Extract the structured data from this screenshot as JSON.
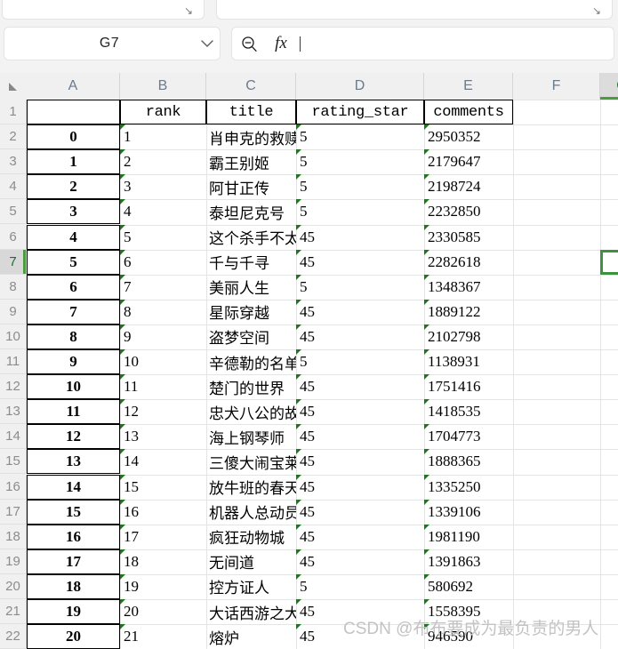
{
  "app": {
    "name_box_value": "G7",
    "name_box_chevron": "chevron-down-icon",
    "formula_value": "",
    "formula_placeholder": "",
    "zoom_out_icon": "magnifier-minus-icon",
    "fx_label": "fx"
  },
  "grid": {
    "column_headers": [
      "A",
      "B",
      "C",
      "D",
      "E",
      "F",
      "G"
    ],
    "selected_column": "G",
    "selected_row": 7,
    "selected_cell": "G7",
    "row_numbers": [
      1,
      2,
      3,
      4,
      5,
      6,
      7,
      8,
      9,
      10,
      11,
      12,
      13,
      14,
      15,
      16,
      17,
      18,
      19,
      20,
      21,
      22
    ],
    "header_row": {
      "A": "",
      "B": "rank",
      "C": "title",
      "D": "rating_star",
      "E": "comments"
    },
    "rows": [
      {
        "index": "0",
        "rank": "1",
        "title": "肖申克的救赎",
        "rating_star": "5",
        "comments": "2950352"
      },
      {
        "index": "1",
        "rank": "2",
        "title": "霸王别姬",
        "rating_star": "5",
        "comments": "2179647"
      },
      {
        "index": "2",
        "rank": "3",
        "title": "阿甘正传",
        "rating_star": "5",
        "comments": "2198724"
      },
      {
        "index": "3",
        "rank": "4",
        "title": "泰坦尼克号",
        "rating_star": "5",
        "comments": "2232850"
      },
      {
        "index": "4",
        "rank": "5",
        "title": "这个杀手不太冷",
        "rating_star": "45",
        "comments": "2330585"
      },
      {
        "index": "5",
        "rank": "6",
        "title": "千与千寻",
        "rating_star": "45",
        "comments": "2282618"
      },
      {
        "index": "6",
        "rank": "7",
        "title": "美丽人生",
        "rating_star": "5",
        "comments": "1348367"
      },
      {
        "index": "7",
        "rank": "8",
        "title": "星际穿越",
        "rating_star": "45",
        "comments": "1889122"
      },
      {
        "index": "8",
        "rank": "9",
        "title": "盗梦空间",
        "rating_star": "45",
        "comments": "2102798"
      },
      {
        "index": "9",
        "rank": "10",
        "title": "辛德勒的名单",
        "rating_star": "5",
        "comments": "1138931"
      },
      {
        "index": "10",
        "rank": "11",
        "title": "楚门的世界",
        "rating_star": "45",
        "comments": "1751416"
      },
      {
        "index": "11",
        "rank": "12",
        "title": "忠犬八公的故事",
        "rating_star": "45",
        "comments": "1418535"
      },
      {
        "index": "12",
        "rank": "13",
        "title": "海上钢琴师",
        "rating_star": "45",
        "comments": "1704773"
      },
      {
        "index": "13",
        "rank": "14",
        "title": "三傻大闹宝莱坞",
        "rating_star": "45",
        "comments": "1888365"
      },
      {
        "index": "14",
        "rank": "15",
        "title": "放牛班的春天",
        "rating_star": "45",
        "comments": "1335250"
      },
      {
        "index": "15",
        "rank": "16",
        "title": "机器人总动员",
        "rating_star": "45",
        "comments": "1339106"
      },
      {
        "index": "16",
        "rank": "17",
        "title": "疯狂动物城",
        "rating_star": "45",
        "comments": "1981190"
      },
      {
        "index": "17",
        "rank": "18",
        "title": "无间道",
        "rating_star": "45",
        "comments": "1391863"
      },
      {
        "index": "18",
        "rank": "19",
        "title": "控方证人",
        "rating_star": "5",
        "comments": "580692"
      },
      {
        "index": "19",
        "rank": "20",
        "title": "大话西游之大圣娶亲",
        "rating_star": "45",
        "comments": "1558395"
      },
      {
        "index": "20",
        "rank": "21",
        "title": "熔炉",
        "rating_star": "45",
        "comments": "946590"
      }
    ]
  },
  "watermark": {
    "text": "CSDN @布布要成为最负责的男人"
  },
  "colors": {
    "selection_green": "#3f9142",
    "header_gray": "#f0f0f0",
    "error_marker_green": "#1a7a1a"
  }
}
